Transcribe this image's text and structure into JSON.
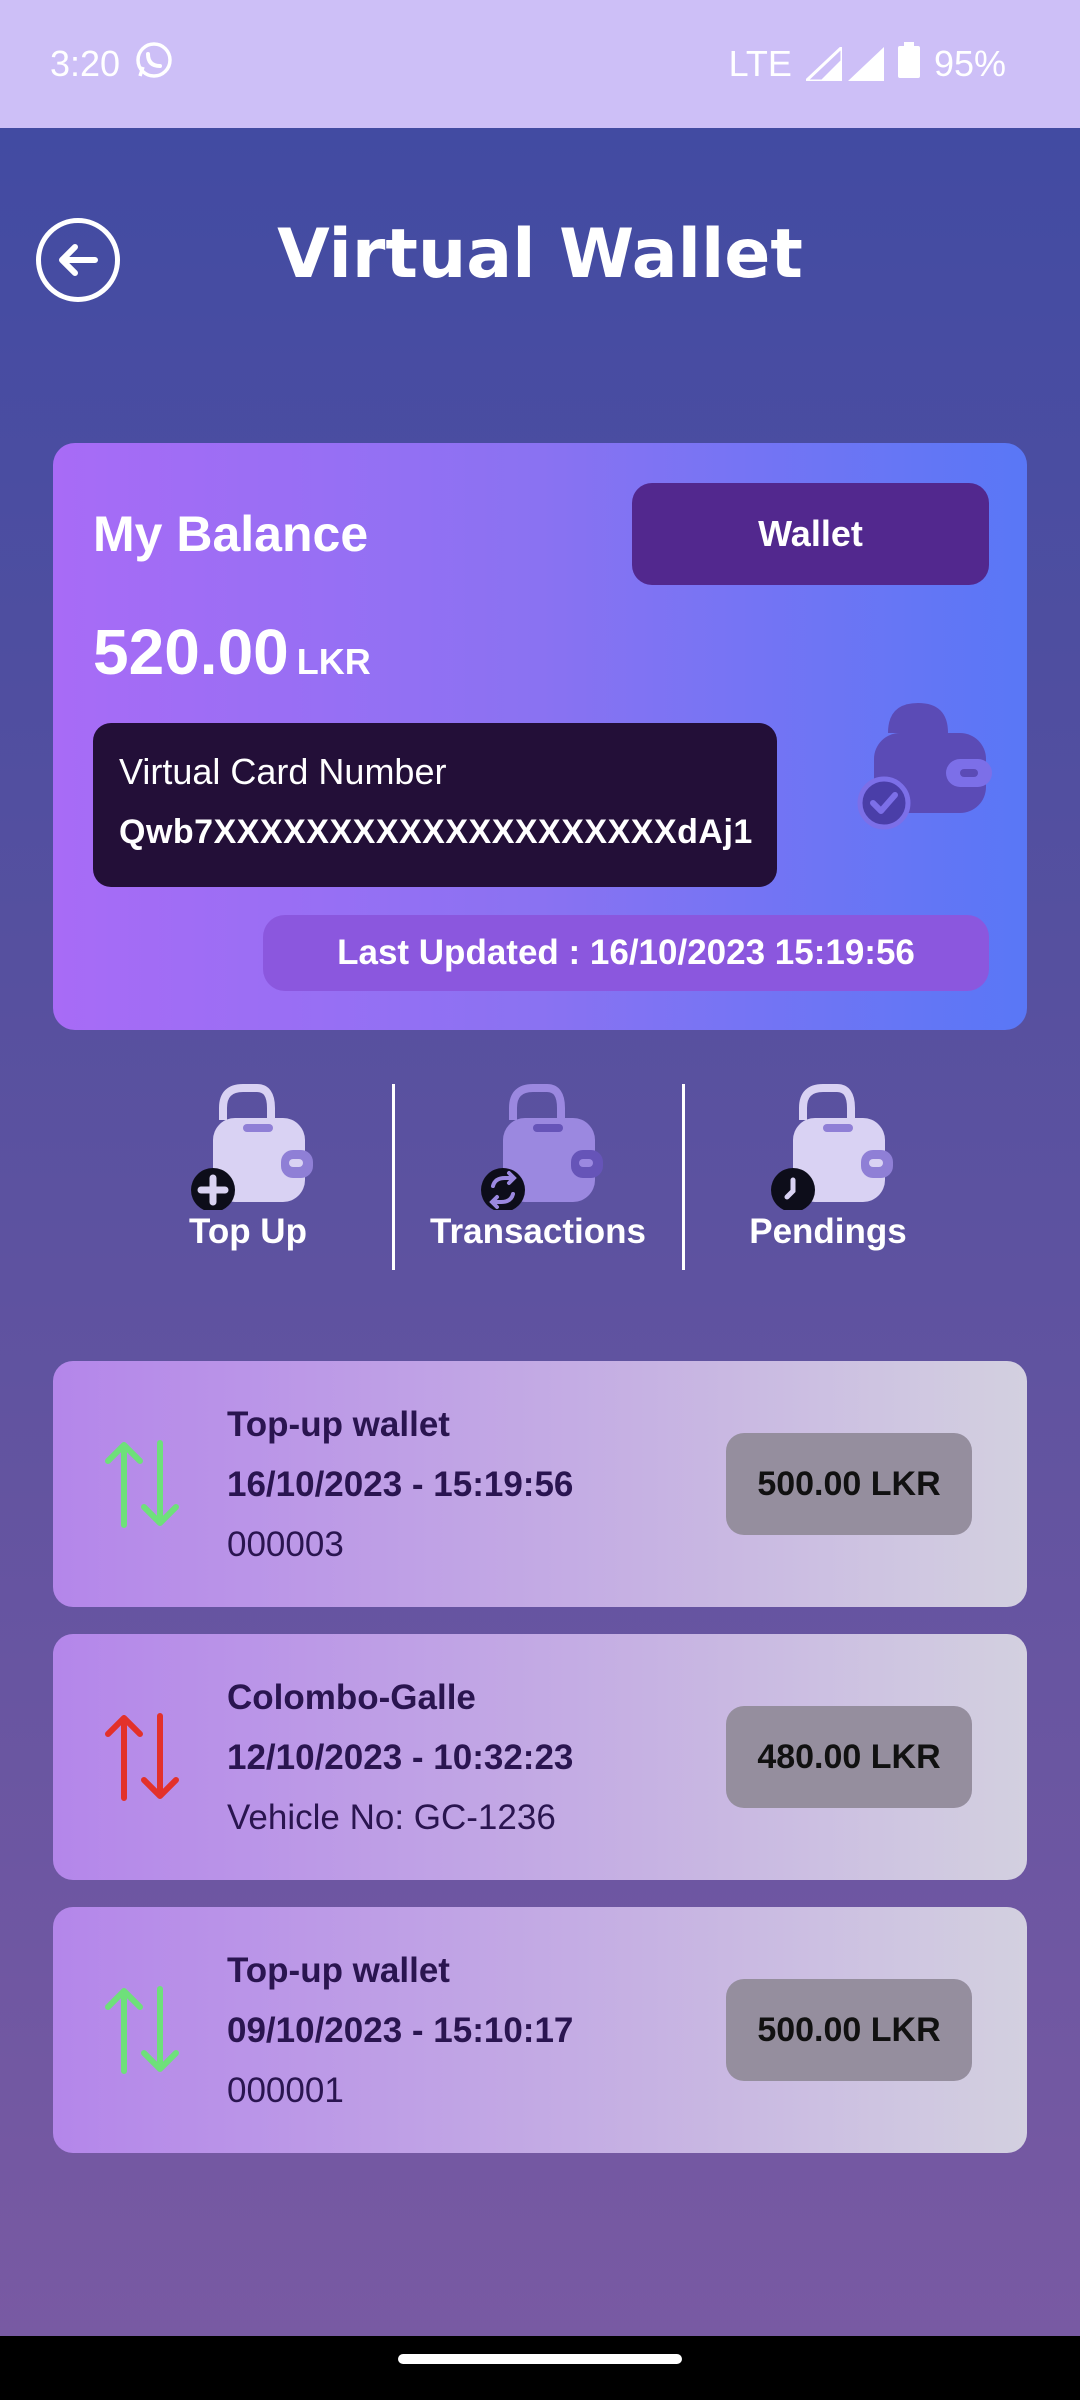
{
  "status_bar": {
    "time": "3:20",
    "network": "LTE",
    "battery": "95%"
  },
  "header": {
    "title": "Virtual Wallet"
  },
  "balance_card": {
    "heading": "My Balance",
    "wallet_button": "Wallet",
    "amount": "520.00",
    "currency": "LKR",
    "card_label": "Virtual Card Number",
    "card_number": "Qwb7XXXXXXXXXXXXXXXXXXXXdAj1",
    "last_updated": "Last Updated : 16/10/2023   15:19:56"
  },
  "actions": [
    {
      "label": "Top Up",
      "icon": "wallet-add-icon"
    },
    {
      "label": "Transactions",
      "icon": "wallet-exchange-icon"
    },
    {
      "label": "Pendings",
      "icon": "wallet-clock-icon"
    }
  ],
  "transactions": [
    {
      "title": "Top-up wallet",
      "datetime": "16/10/2023 - 15:19:56",
      "ref": "000003",
      "amount": "500.00 LKR",
      "arrow_color": "#6ee07a"
    },
    {
      "title": "Colombo-Galle",
      "datetime": "12/10/2023 - 10:32:23",
      "ref": "Vehicle No: GC-1236",
      "amount": "480.00 LKR",
      "arrow_color": "#e3312a"
    },
    {
      "title": "Top-up wallet",
      "datetime": "09/10/2023 - 15:10:17",
      "ref": "000001",
      "amount": "500.00 LKR",
      "arrow_color": "#6ee07a"
    }
  ],
  "colors": {
    "status_bar": "#cdbff7",
    "wallet_button": "#52288e",
    "card_dark": "#230f38"
  }
}
